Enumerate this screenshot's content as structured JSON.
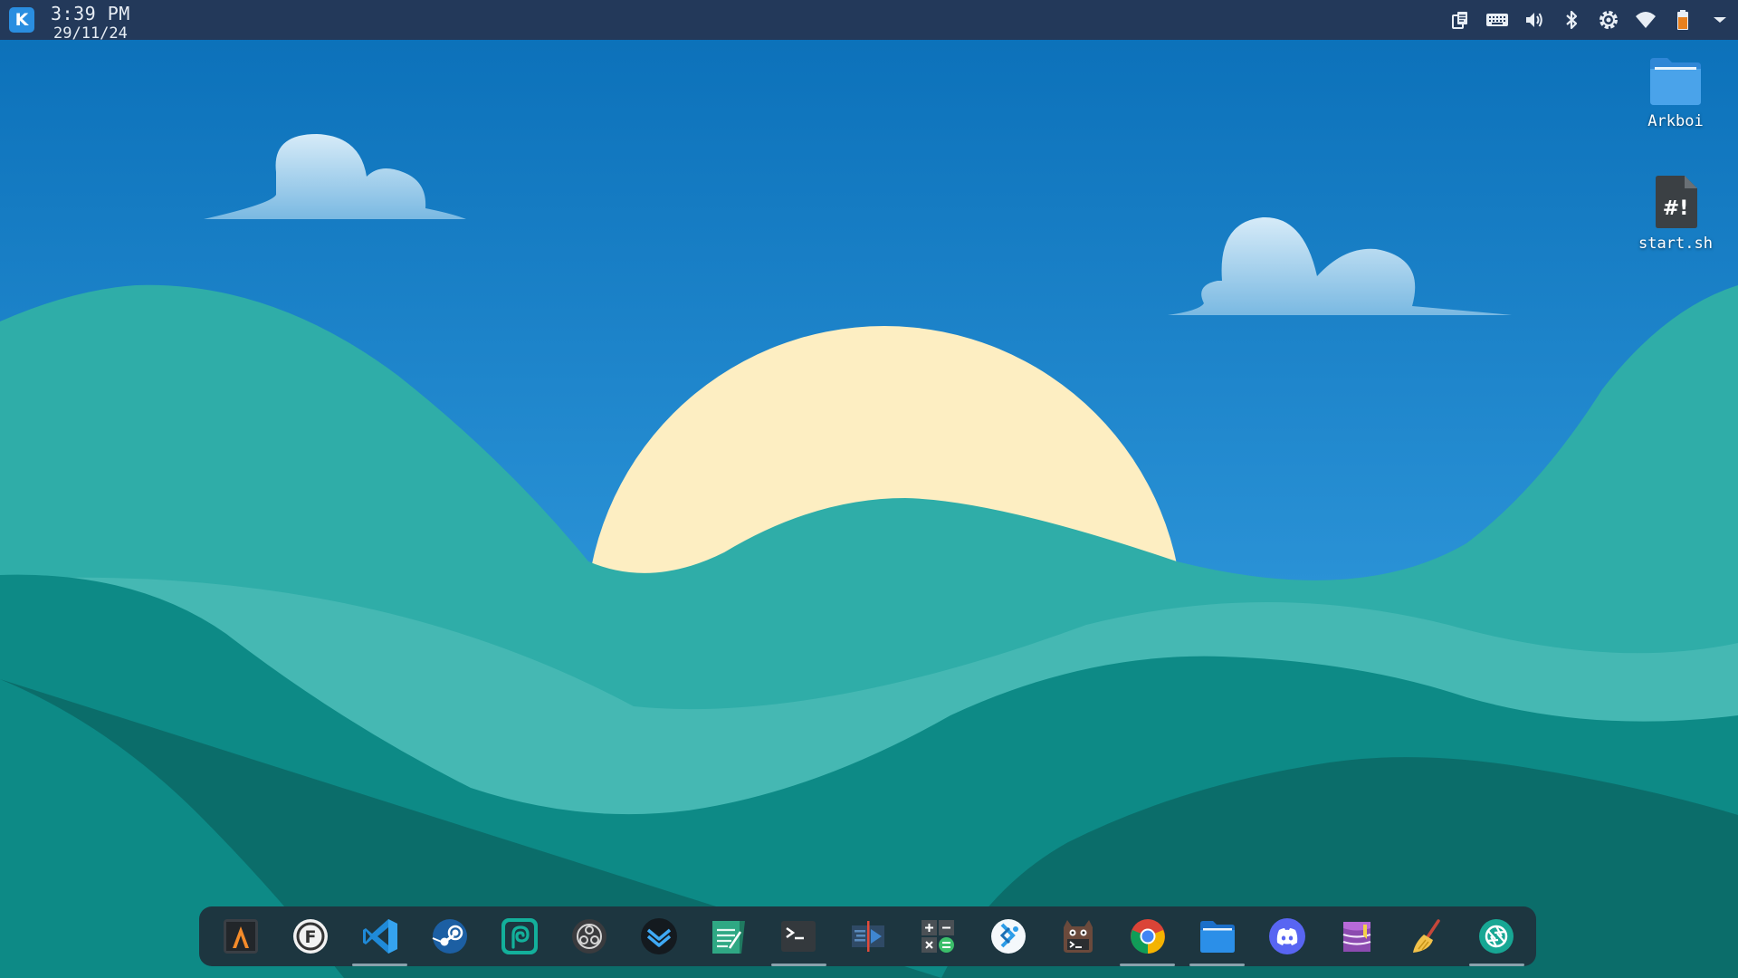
{
  "panel": {
    "launcher_icon": "kde-logo-icon",
    "clock": {
      "time": "3:39 PM",
      "date": "29/11/24"
    },
    "tray_icons": [
      "clipboard-icon",
      "keyboard-icon",
      "volume-icon",
      "bluetooth-icon",
      "settings-icon",
      "wifi-icon",
      "battery-icon",
      "chevron-down-icon"
    ]
  },
  "desktop": {
    "icons": [
      {
        "label": "Arkboi",
        "icon": "folder-icon"
      },
      {
        "label": "start.sh",
        "icon": "script-file-icon"
      }
    ]
  },
  "dock": {
    "apps": [
      {
        "name": "alacritty",
        "icon": "alacritty-icon",
        "active": false
      },
      {
        "name": "flatpak",
        "icon": "f-circle-icon",
        "active": false
      },
      {
        "name": "vscode",
        "icon": "vscode-icon",
        "active": true
      },
      {
        "name": "steam",
        "icon": "steam-icon",
        "active": false
      },
      {
        "name": "pycharm",
        "icon": "spiral-icon",
        "active": false
      },
      {
        "name": "obs",
        "icon": "obs-icon",
        "active": false
      },
      {
        "name": "mail",
        "icon": "mail-icon",
        "active": false
      },
      {
        "name": "notes",
        "icon": "notes-icon",
        "active": false
      },
      {
        "name": "terminal",
        "icon": "terminal-icon",
        "active": true
      },
      {
        "name": "kdenlive",
        "icon": "video-editor-icon",
        "active": false
      },
      {
        "name": "calculator",
        "icon": "calculator-icon",
        "active": false
      },
      {
        "name": "kdeconnect",
        "icon": "kde-discover-icon",
        "active": false
      },
      {
        "name": "sysmonitor",
        "icon": "cat-terminal-icon",
        "active": false
      },
      {
        "name": "chrome",
        "icon": "chrome-icon",
        "active": true
      },
      {
        "name": "files",
        "icon": "file-manager-icon",
        "active": true
      },
      {
        "name": "discord",
        "icon": "discord-icon",
        "active": false
      },
      {
        "name": "database",
        "icon": "database-icon",
        "active": false
      },
      {
        "name": "cleaner",
        "icon": "broom-icon",
        "active": false
      },
      {
        "name": "screenshot",
        "icon": "camera-shutter-icon",
        "active": true
      }
    ]
  },
  "colors": {
    "panel_bg": "#23395a",
    "dock_bg": "#1d3640",
    "sky_top": "#0a6fb8",
    "sun": "#fdeec2",
    "hill_light": "#2fada8",
    "hill_dark": "#0b6d6a"
  }
}
